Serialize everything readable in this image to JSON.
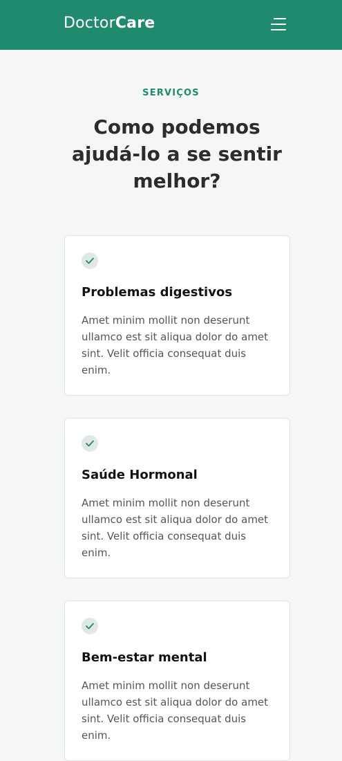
{
  "header": {
    "logo_light": "Doctor",
    "logo_bold": "Care",
    "background": "#1f8a6e",
    "menu_icon": "hamburger-menu-icon"
  },
  "services": {
    "tag": "SERVIÇOS",
    "title": "Como podemos ajudá-lo a se sentir melhor?",
    "cards": [
      {
        "icon": "check-icon",
        "title": "Problemas digestivos",
        "text": "Amet minim mollit non deserunt ullamco est sit aliqua dolor do amet sint. Velit officia consequat duis enim."
      },
      {
        "icon": "check-icon",
        "title": "Saúde Hormonal",
        "text": "Amet minim mollit non deserunt ullamco est sit aliqua dolor do amet sint. Velit officia consequat duis enim."
      },
      {
        "icon": "check-icon",
        "title": "Bem-estar mental",
        "text": "Amet minim mollit non deserunt ullamco est sit aliqua dolor do amet sint. Velit officia consequat duis enim."
      }
    ]
  }
}
